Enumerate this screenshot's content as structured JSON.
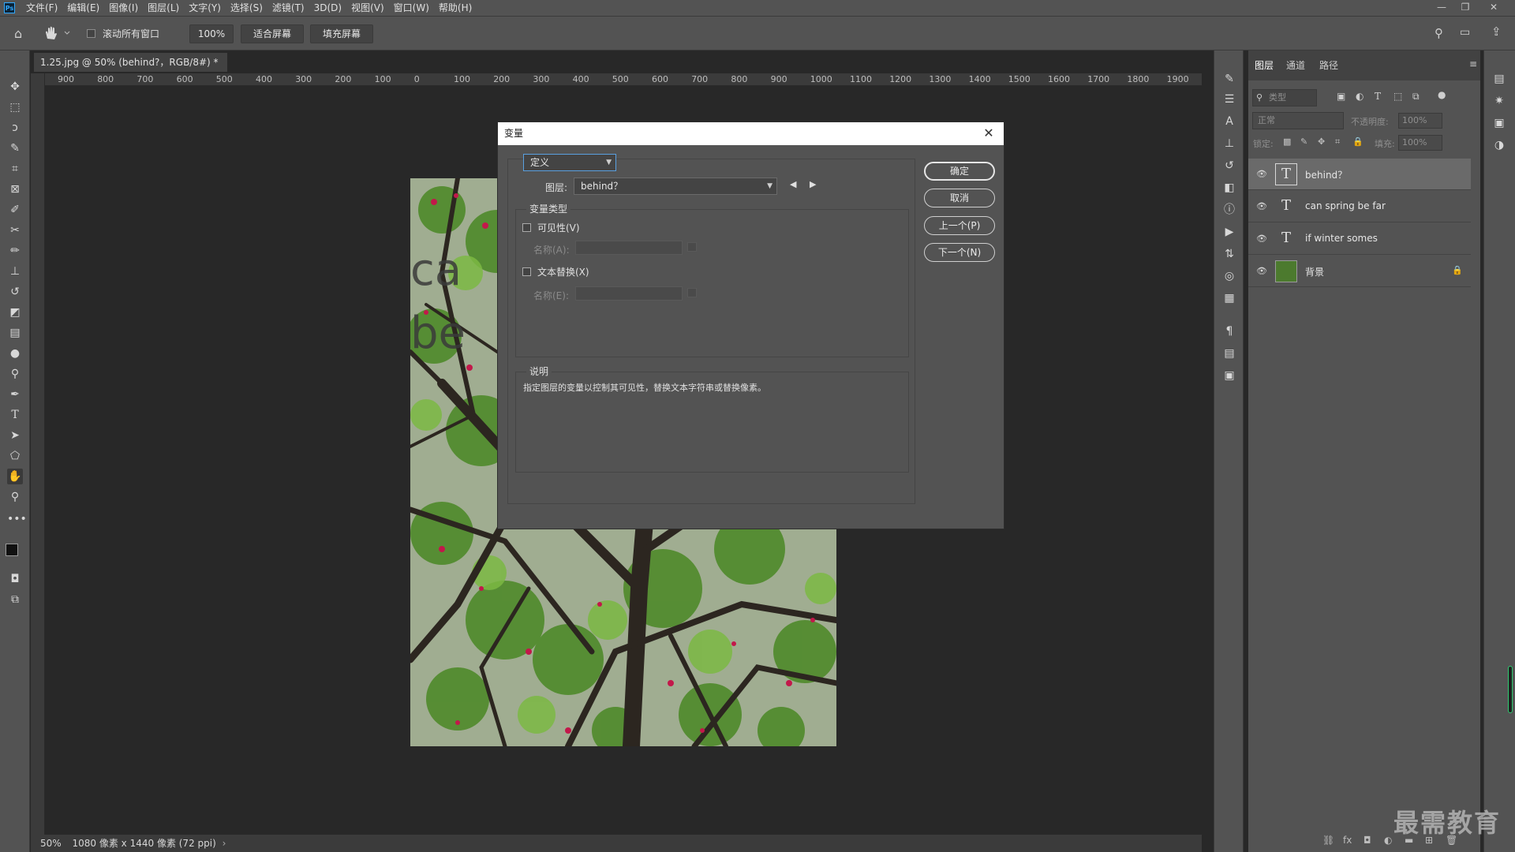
{
  "app": {
    "logo": "Ps",
    "menu": [
      "文件(F)",
      "编辑(E)",
      "图像(I)",
      "图层(L)",
      "文字(Y)",
      "选择(S)",
      "滤镜(T)",
      "3D(D)",
      "视图(V)",
      "窗口(W)",
      "帮助(H)"
    ]
  },
  "options": {
    "scroll_all_label": "滚动所有窗口",
    "zoom_value": "100%",
    "fit_screen": "适合屏幕",
    "fill_screen": "填充屏幕"
  },
  "document": {
    "tab_title": "1.25.jpg @ 50% (behind?，RGB/8#) *",
    "ruler_labels": [
      "900",
      "800",
      "700",
      "600",
      "500",
      "400",
      "300",
      "200",
      "100",
      "0",
      "100",
      "200",
      "300",
      "400",
      "500",
      "600",
      "700",
      "800",
      "900",
      "1000",
      "1100",
      "1200",
      "1300",
      "1400",
      "1500",
      "1600",
      "1700",
      "1800",
      "1900"
    ],
    "status_zoom": "50%",
    "status_info": "1080 像素 x 1440 像素 (72 ppi)",
    "canvas_text_1": "ca",
    "canvas_text_2": "be"
  },
  "dialog": {
    "title": "变量",
    "define_select": "定义",
    "layer_label": "图层:",
    "layer_value": "behind？",
    "var_type_legend": "变量类型",
    "visibility_label": "可见性(V)",
    "name_a_label": "名称(A):",
    "text_replace_label": "文本替换(X)",
    "name_e_label": "名称(E):",
    "desc_legend": "说明",
    "desc_text": "指定图层的变量以控制其可见性，替换文本字符串或替换像素。",
    "buttons": {
      "ok": "确定",
      "cancel": "取消",
      "prev": "上一个(P)",
      "next": "下一个(N)"
    }
  },
  "layers_panel": {
    "tabs": [
      "图层",
      "通道",
      "路径"
    ],
    "filter_label": "类型",
    "blend_mode": "正常",
    "opacity_label": "不透明度:",
    "opacity_value": "100%",
    "lock_label": "锁定:",
    "fill_label": "填充:",
    "fill_value": "100%",
    "layers": [
      {
        "name": "behind？",
        "type": "text",
        "selected": true
      },
      {
        "name": "can spring be far",
        "type": "text",
        "selected": false
      },
      {
        "name": "if winter somes",
        "type": "text",
        "selected": false
      },
      {
        "name": "背景",
        "type": "image",
        "selected": false,
        "locked": true
      }
    ]
  },
  "watermark": "最需教育",
  "colors": {
    "ui_bg": "#535353",
    "canvas_bg": "#282828",
    "selected_layer": "#6a6a6a",
    "accent": "#31a8ff"
  }
}
